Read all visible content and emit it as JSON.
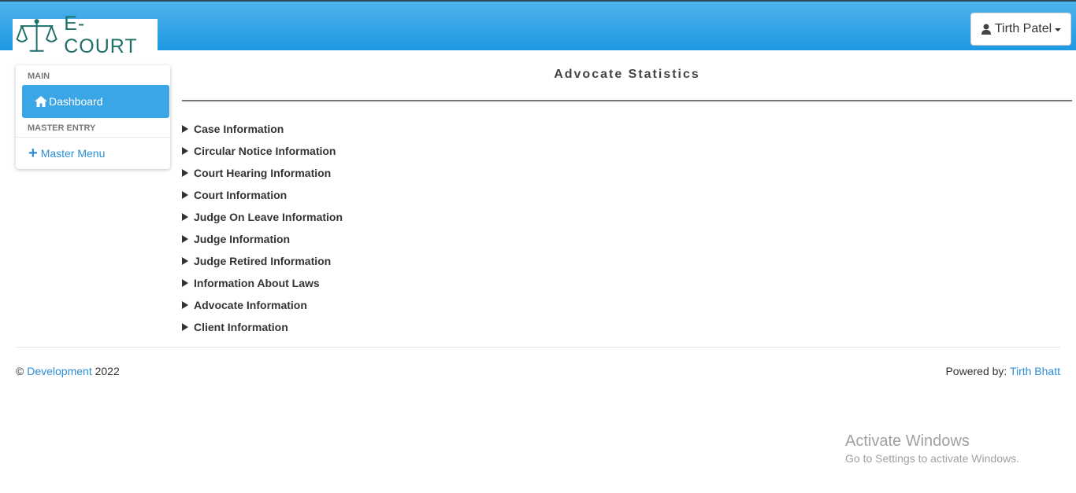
{
  "header": {
    "logo_text": "E-COURT",
    "user_name": "Tirth Patel"
  },
  "sidebar": {
    "section_main": "MAIN",
    "dashboard_label": "Dashboard",
    "section_master": "MASTER ENTRY",
    "master_menu_label": "Master Menu"
  },
  "main": {
    "title": "Advocate Statistics",
    "items": [
      {
        "label": "Case Information"
      },
      {
        "label": "Circular Notice Information"
      },
      {
        "label": "Court Hearing Information"
      },
      {
        "label": "Court Information"
      },
      {
        "label": "Judge On Leave Information"
      },
      {
        "label": "Judge Information"
      },
      {
        "label": "Judge Retired Information"
      },
      {
        "label": "Information About Laws"
      },
      {
        "label": "Advocate Information"
      },
      {
        "label": "Client Information"
      }
    ]
  },
  "footer": {
    "copyright_symbol": "©",
    "dev_link": "Development",
    "year": "2022",
    "powered_by": "Powered by:",
    "author_link": "Tirth Bhatt"
  },
  "watermark": {
    "line1": "Activate Windows",
    "line2": "Go to Settings to activate Windows."
  },
  "colors": {
    "header_top": "#4fb3ec",
    "header_bottom": "#1e98e3",
    "active_item": "#3ba6e6",
    "link": "#2a8fd6",
    "logo_text": "#1f6f6a"
  }
}
